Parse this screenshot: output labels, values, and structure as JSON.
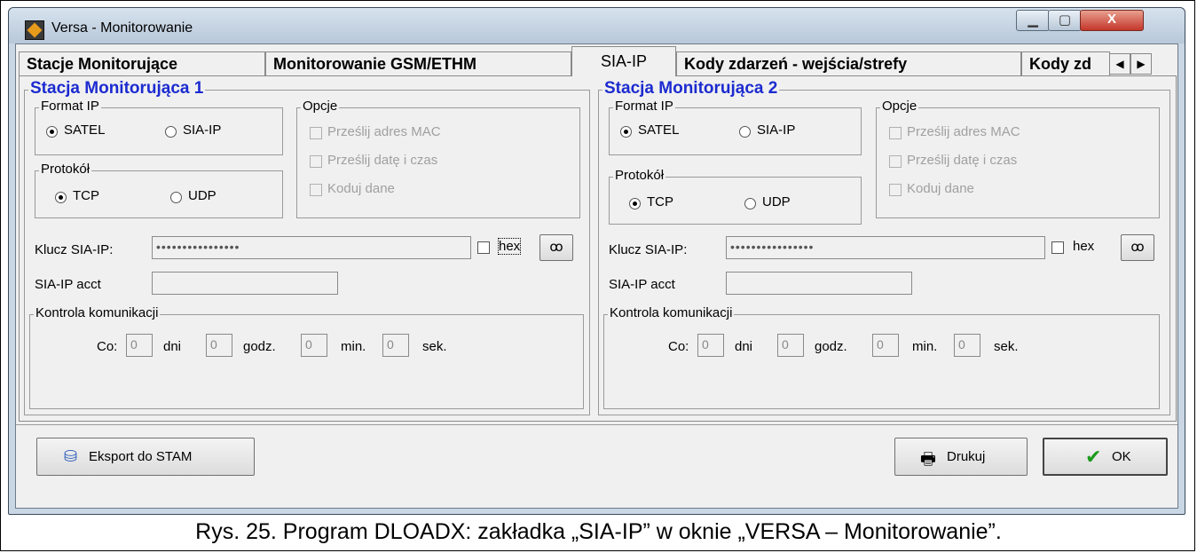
{
  "window": {
    "title": "Versa - Monitorowanie",
    "close_glyph": "X"
  },
  "tabs": [
    {
      "label": "Stacje Monitorujące"
    },
    {
      "label": "Monitorowanie GSM/ETHM"
    },
    {
      "label": "SIA-IP"
    },
    {
      "label": "Kody zdarzeń - wejścia/strefy"
    },
    {
      "label": "Kody zd"
    }
  ],
  "tab_scroll": {
    "left": "◀",
    "right": "▶"
  },
  "stations": [
    {
      "title": "Stacja Monitorująca 1",
      "format_ip": {
        "legend": "Format IP",
        "options": [
          "SATEL",
          "SIA-IP"
        ],
        "selected": "SATEL"
      },
      "protocol": {
        "legend": "Protokół",
        "options": [
          "TCP",
          "UDP"
        ],
        "selected": "TCP"
      },
      "options": {
        "legend": "Opcje",
        "items": [
          "Prześlij adres MAC",
          "Prześlij datę i czas",
          "Koduj dane"
        ]
      },
      "key_label": "Klucz SIA-IP:",
      "key_value": "••••••••••••••••",
      "hex_label": "hex",
      "acct_label": "SIA-IP acct",
      "acct_value": "",
      "comm": {
        "legend": "Kontrola komunikacji",
        "co": "Co:",
        "dni": "dni",
        "godz": "godz.",
        "min": "min.",
        "sek": "sek.",
        "values": [
          "0",
          "0",
          "0",
          "0"
        ]
      }
    },
    {
      "title": "Stacja Monitorująca 2",
      "format_ip": {
        "legend": "Format IP",
        "options": [
          "SATEL",
          "SIA-IP"
        ],
        "selected": "SATEL"
      },
      "protocol": {
        "legend": "Protokół",
        "options": [
          "TCP",
          "UDP"
        ],
        "selected": "TCP"
      },
      "options": {
        "legend": "Opcje",
        "items": [
          "Prześlij adres MAC",
          "Prześlij datę i czas",
          "Koduj dane"
        ]
      },
      "key_label": "Klucz SIA-IP:",
      "key_value": "••••••••••••••••",
      "hex_label": "hex",
      "acct_label": "SIA-IP acct",
      "acct_value": "",
      "comm": {
        "legend": "Kontrola komunikacji",
        "co": "Co:",
        "dni": "dni",
        "godz": "godz.",
        "min": "min.",
        "sek": "sek.",
        "values": [
          "0",
          "0",
          "0",
          "0"
        ]
      }
    }
  ],
  "buttons": {
    "export": "Eksport do STAM",
    "print": "Drukuj",
    "ok": "OK"
  },
  "caption": "Rys. 25. Program DLOADX: zakładka „SIA-IP” w oknie „VERSA – Monitorowanie”."
}
